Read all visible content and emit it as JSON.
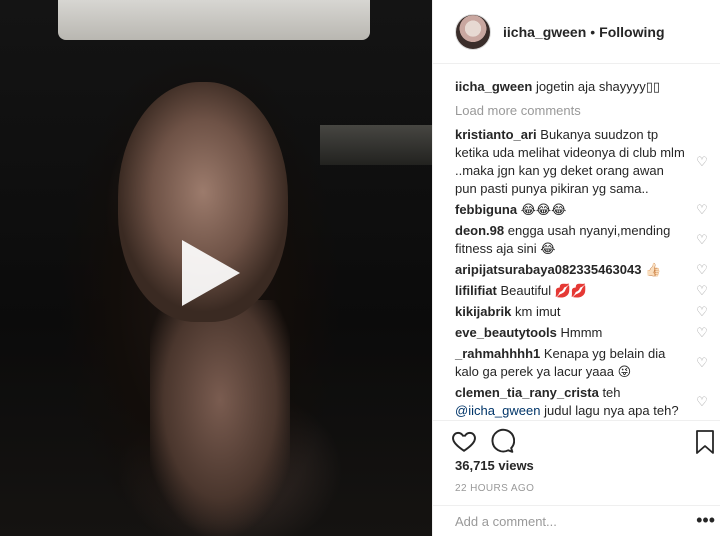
{
  "post": {
    "username": "iicha_gween",
    "follow_status": "Following",
    "separator": "•",
    "caption_user": "iicha_gween",
    "caption_text": "jogetin aja shayyyy▯▯"
  },
  "comments_section": {
    "load_more": "Load more comments",
    "items": [
      {
        "user": "kristianto_ari",
        "text": "Bukanya suudzon tp ketika uda melihat videonya di club mlm ..maka jgn kan yg deket orang awan pun pasti punya pikiran yg sama.."
      },
      {
        "user": "febbiguna",
        "text": "😂😂😂"
      },
      {
        "user": "deon.98",
        "text": "engga usah nyanyi,mending fitness aja sini 😂"
      },
      {
        "user": "aripijatsurabaya082335463043",
        "text": "👍🏻"
      },
      {
        "user": "lifilifiat",
        "text": "Beautiful 💋💋"
      },
      {
        "user": "kikijabrik",
        "text": "km imut"
      },
      {
        "user": "eve_beautytools",
        "text": "Hmmm"
      },
      {
        "user": "_rahmahhhh1",
        "text": "Kenapa yg belain dia kalo ga perek ya lacur yaaa 😜"
      },
      {
        "user": "clemen_tia_rany_crista",
        "text": "teh",
        "mention": "@iicha_gween",
        "text2": "judul lagu nya apa teh?"
      }
    ]
  },
  "stats": {
    "views": "36,715 views",
    "timestamp": "22 HOURS AGO"
  },
  "add_comment": {
    "placeholder": "Add a comment...",
    "more_icon": "•••"
  },
  "icons": {
    "play": "play-icon",
    "like": "heart-icon",
    "comment": "comment-icon",
    "save": "bookmark-icon",
    "more": "more-icon"
  },
  "colors": {
    "text": "#262626",
    "muted": "#999999",
    "mention": "#003569",
    "border": "#efefef"
  }
}
